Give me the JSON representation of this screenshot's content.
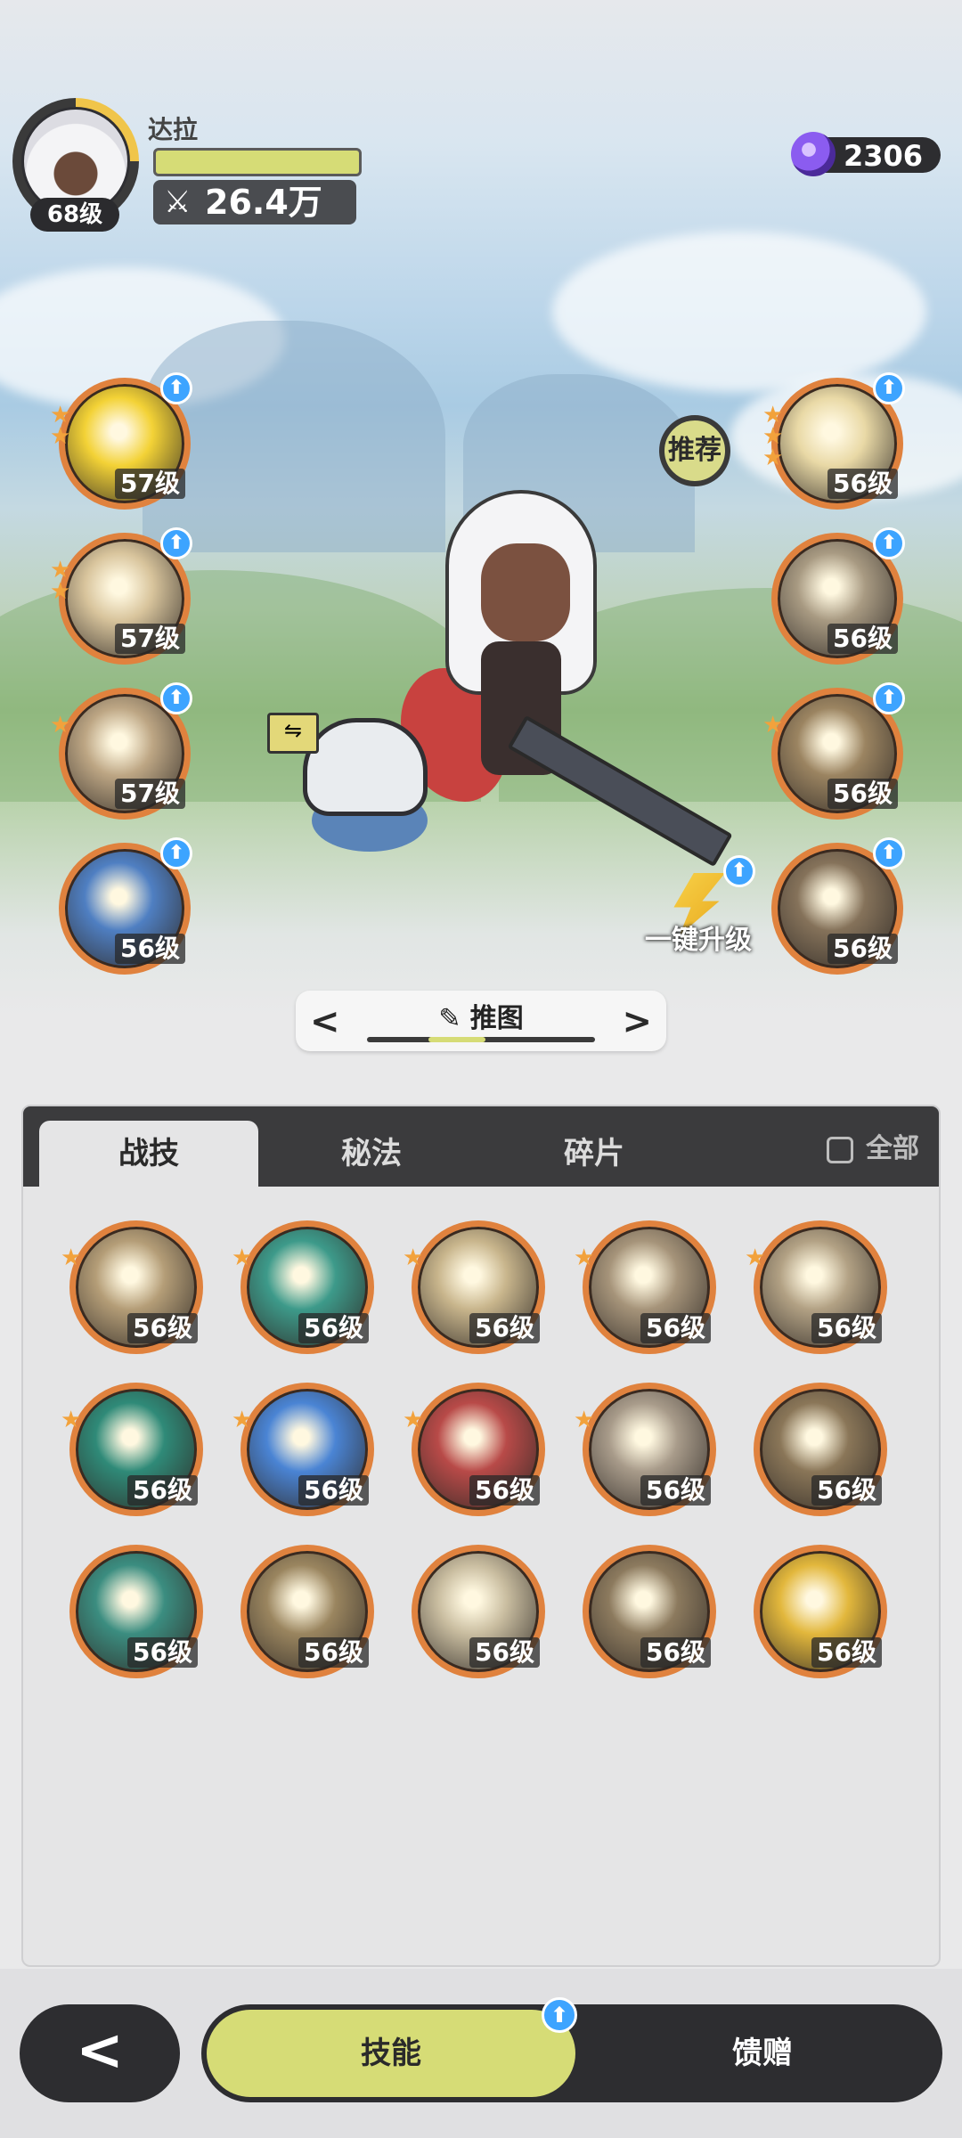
{
  "player": {
    "name": "达拉",
    "level": "68级",
    "power": "26.4万",
    "power_icon": "crossed-swords-icon"
  },
  "currency": {
    "icon": "purple-gem-icon",
    "value": "2306"
  },
  "recommend_label": "推荐",
  "one_click_upgrade_label": "一键升级",
  "upgrade_badge_glyph": "⬆",
  "left_skills": [
    {
      "level": "57级",
      "stars": 2,
      "color": "#f3d236"
    },
    {
      "level": "57级",
      "stars": 2,
      "color": "#d8c49c"
    },
    {
      "level": "57级",
      "stars": 1,
      "color": "#bda684"
    },
    {
      "level": "56级",
      "stars": 0,
      "color": "#4f7fc2"
    }
  ],
  "right_skills": [
    {
      "level": "56级",
      "stars": 3,
      "color": "#e9d9a6"
    },
    {
      "level": "56级",
      "stars": 0,
      "color": "#a89a82"
    },
    {
      "level": "56级",
      "stars": 1,
      "color": "#9b8461"
    },
    {
      "level": "56级",
      "stars": 0,
      "color": "#85725a"
    }
  ],
  "stage": {
    "label": "推图",
    "prev_glyph": "<",
    "next_glyph": ">",
    "edit_icon": "pencil-icon",
    "progress": 0.25
  },
  "tabs": {
    "combat": "战技",
    "secret": "秘法",
    "fragment": "碎片",
    "all_label": "全部"
  },
  "grid_skills": [
    {
      "level": "56级",
      "stars": 1,
      "color": "#b49d77"
    },
    {
      "level": "56级",
      "stars": 1,
      "color": "#3d9a8a"
    },
    {
      "level": "56级",
      "stars": 1,
      "color": "#c8b58c"
    },
    {
      "level": "56级",
      "stars": 1,
      "color": "#a6947a"
    },
    {
      "level": "56级",
      "stars": 1,
      "color": "#b2a184"
    },
    {
      "level": "56级",
      "stars": 1,
      "color": "#2f8a78"
    },
    {
      "level": "56级",
      "stars": 1,
      "color": "#4a84d4"
    },
    {
      "level": "56级",
      "stars": 1,
      "color": "#b84a48"
    },
    {
      "level": "56级",
      "stars": 1,
      "color": "#a89b8a"
    },
    {
      "level": "56级",
      "stars": 0,
      "color": "#8a7658"
    },
    {
      "level": "56级",
      "stars": 0,
      "color": "#3b8d80"
    },
    {
      "level": "56级",
      "stars": 0,
      "color": "#9a855f"
    },
    {
      "level": "56级",
      "stars": 0,
      "color": "#c9bda0"
    },
    {
      "level": "56级",
      "stars": 0,
      "color": "#8c7a5e"
    },
    {
      "level": "56级",
      "stars": 0,
      "color": "#e2b73c"
    }
  ],
  "bottom": {
    "back_glyph": "<",
    "skills_label": "技能",
    "gift_label": "馈赠",
    "badge_glyph": "⬆"
  },
  "colors": {
    "accent": "#d6dc76",
    "ring": "#e0823e",
    "dark": "#2d2d30",
    "badge": "#3da4ff"
  }
}
